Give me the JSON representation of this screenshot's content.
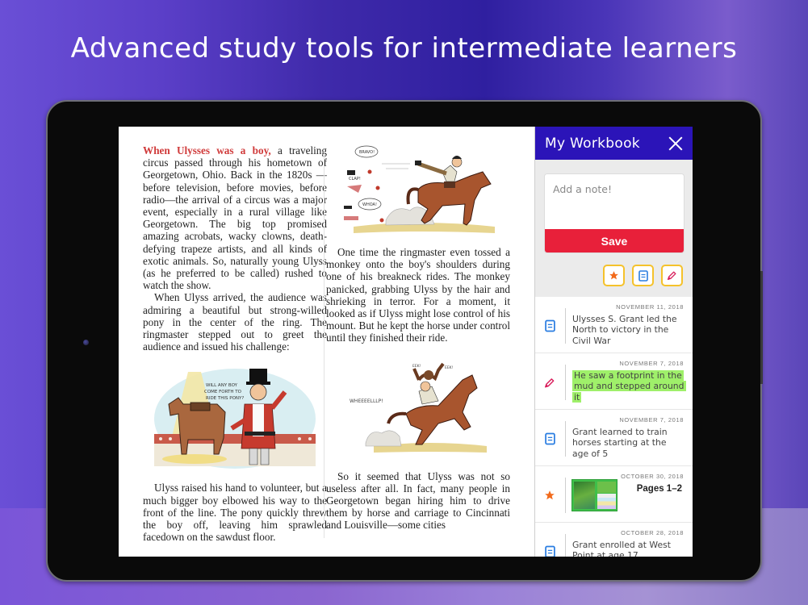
{
  "headline": "Advanced study tools for intermediate learners",
  "book": {
    "left_column": {
      "lead": "When Ulysses was a boy,",
      "p1_rest": " a traveling circus passed through his hometown of Georgetown, Ohio. Back in the 1820s —before television, before movies, before radio—the arrival of a circus was a major event, especially in a rural village like Georgetown. The big top promised amazing acrobats, wacky clowns, death-defying trapeze artists, and all kinds of exotic animals. So, naturally young Ulyss (as he preferred to be called) rushed to watch the show.",
      "p2": "When Ulyss arrived, the audience was admiring a beautiful but strong-willed pony in the center of the ring. The ringmaster stepped out to greet the audience and issued his challenge:",
      "illustration_speech": "WILL ANY BOY COME FORTH TO RIDE THIS PONY?",
      "p3": "Ulyss raised his hand to volunteer, but a much bigger boy elbowed his way to the front of the line. The pony quickly threw the boy off, leaving him sprawled facedown on the sawdust floor."
    },
    "right_column": {
      "illustration1_speech": [
        "BRAVO!",
        "WHOA!",
        "CLAP!"
      ],
      "p1": "One time the ringmaster even tossed a monkey onto the boy's shoulders during one of his breakneck rides. The monkey panicked, grabbing Ulyss by the hair and shrieking in terror. For a moment, it looked as if Ulyss might lose control of his mount. But he kept the horse under control until they finished their ride.",
      "illustration2_speech": [
        "WHEEEELLLP!",
        "EEK!",
        "EEK!"
      ],
      "p2": "So it seemed that Ulyss was not so useless after all. In fact, many people in Georgetown began hiring him to drive them by horse and carriage to Cincinnati and Louisville—some cities"
    }
  },
  "workbook": {
    "title": "My Workbook",
    "close_icon": "close-icon",
    "note_placeholder": "Add a note!",
    "save_label": "Save",
    "filters": [
      {
        "name": "bookmarks",
        "icon": "star-icon",
        "color": "#f26a1b"
      },
      {
        "name": "notes",
        "icon": "note-icon",
        "color": "#2a7de1"
      },
      {
        "name": "highlights",
        "icon": "pencil-icon",
        "color": "#d81b5a"
      }
    ],
    "accent_colors": {
      "header": "#2b14b8",
      "save": "#e8203a",
      "filter_border": "#f5c22b",
      "highlight": "#9ff06a"
    },
    "entries": [
      {
        "type": "note",
        "date": "NOVEMBER 11, 2018",
        "text": "Ulysses S. Grant led the North to victory in the Civil War"
      },
      {
        "type": "highlight",
        "date": "NOVEMBER 7, 2018",
        "text": "He saw a footprint in the mud and stepped around it"
      },
      {
        "type": "note",
        "date": "NOVEMBER 7, 2018",
        "text": "Grant learned to train horses starting at the age of 5"
      },
      {
        "type": "bookmark",
        "date": "OCTOBER 30, 2018",
        "text": "Pages 1–2"
      },
      {
        "type": "note",
        "date": "OCTOBER 28, 2018",
        "text": "Grant enrolled at West Point at age 17"
      }
    ]
  }
}
